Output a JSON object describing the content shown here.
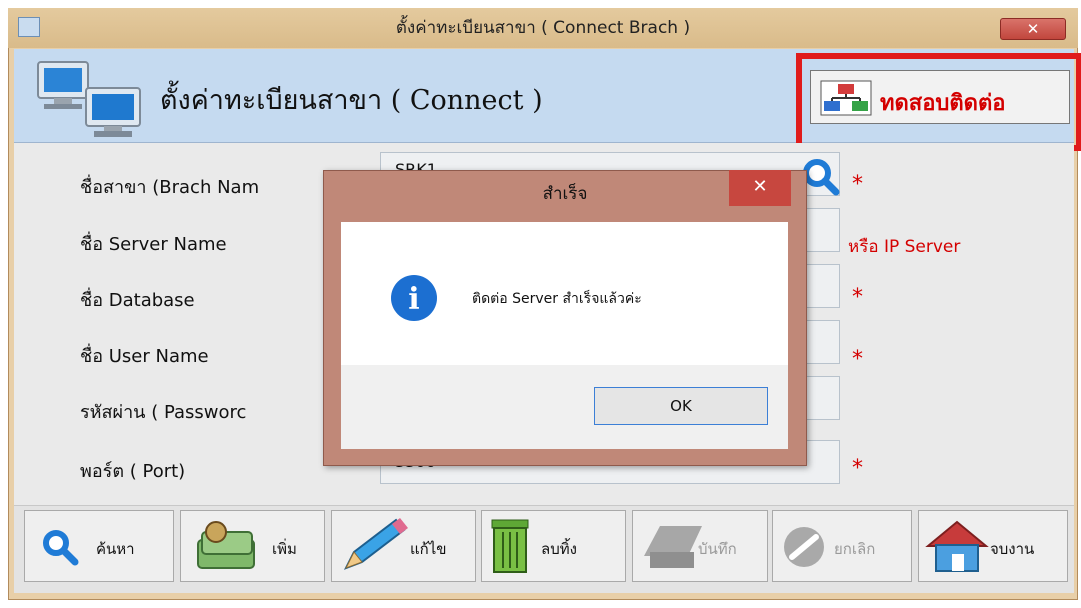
{
  "window": {
    "title": "ตั้งค่าทะเบียนสาขา ( Connect Brach )",
    "close_glyph": "✕"
  },
  "header": {
    "title": "ตั้งค่าทะเบียนสาขา ( Connect )",
    "test_button_label": "ทดสอบติดต่อ"
  },
  "form": {
    "fields": [
      {
        "label": "ชื่อสาขา (Brach Nam",
        "value": "SRK1",
        "marker": "*"
      },
      {
        "label": "ชื่อ  Server Name",
        "value": "",
        "marker": "หรือ IP Server"
      },
      {
        "label": "ชื่อ Database",
        "value": "",
        "marker": "*"
      },
      {
        "label": "ชื่อ User Name",
        "value": "",
        "marker": "*"
      },
      {
        "label": "รหัสผ่าน ( Passworc",
        "value": "",
        "marker": ""
      },
      {
        "label": "พอร์ต ( Port)",
        "value": "3306",
        "marker": "*"
      }
    ]
  },
  "dialog": {
    "title": "สำเร็จ",
    "close_glyph": "✕",
    "message": "ติดต่อ Server สำเร็จแล้วค่ะ",
    "ok_label": "OK",
    "info_glyph": "i"
  },
  "toolbar": {
    "buttons": [
      {
        "label": "ค้นหา",
        "icon": "search-icon",
        "enabled": true
      },
      {
        "label": "เพิ่ม",
        "icon": "money-icon",
        "enabled": true
      },
      {
        "label": "แก้ไข",
        "icon": "pencil-icon",
        "enabled": true
      },
      {
        "label": "ลบทิ้ง",
        "icon": "trash-icon",
        "enabled": true
      },
      {
        "label": "บันทึก",
        "icon": "save-icon",
        "enabled": false
      },
      {
        "label": "ยกเลิก",
        "icon": "cancel-icon",
        "enabled": false
      },
      {
        "label": "จบงาน",
        "icon": "home-icon",
        "enabled": true
      }
    ]
  },
  "colors": {
    "accent_red": "#d40000",
    "header_blue": "#c5daf0",
    "dialog_title": "#c08878"
  }
}
